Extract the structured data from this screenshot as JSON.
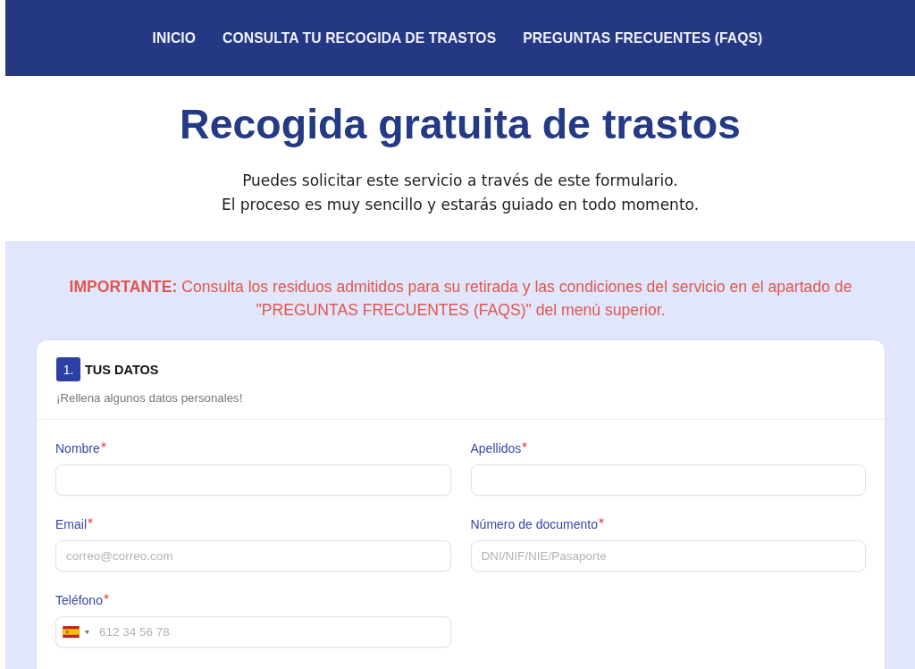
{
  "nav": {
    "items": [
      {
        "label": "INICIO"
      },
      {
        "label": "CONSULTA TU RECOGIDA DE TRASTOS"
      },
      {
        "label": "PREGUNTAS FRECUENTES (FAQS)"
      }
    ]
  },
  "hero": {
    "title": "Recogida gratuita de trastos",
    "subtitle_lines": [
      "Puedes solicitar este servicio a través de este formulario.",
      "El proceso es muy sencillo y estarás guiado en todo momento."
    ]
  },
  "notice": {
    "text": "**IMPORTANTE:** Consulta los residuos admitidos para su retirada y las condiciones del servicio en el apartado de \"PREGUNTAS FRECUENTES (FAQS)\" del menú superior."
  },
  "form_section": {
    "step": "1.",
    "title": "TUS DATOS",
    "description": "¡Rellena algunos datos personales!",
    "fields": [
      {
        "kind": "text",
        "label": "Nombre",
        "required": true
      },
      {
        "kind": "text",
        "label": "Apellidos",
        "required": true
      },
      {
        "kind": "text",
        "label": "Email",
        "required": true,
        "placeholder": "correo@correo.com"
      },
      {
        "kind": "text",
        "label": "Número de documento",
        "required": true,
        "placeholder": "DNI/NIF/NIE/Pasaporte"
      },
      {
        "kind": "phone",
        "label": "Teléfono",
        "required": true,
        "placeholder": "612 34 56 78"
      }
    ]
  }
}
